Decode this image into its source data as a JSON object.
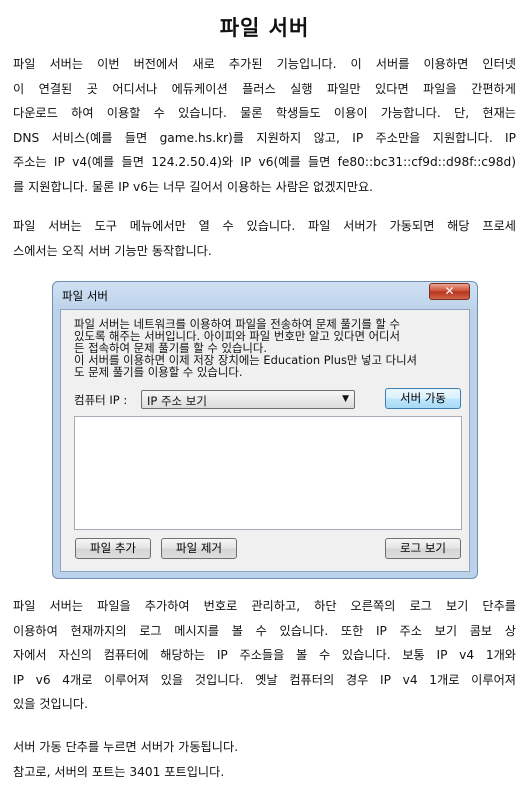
{
  "page": {
    "title": "파일 서버",
    "p1": [
      "파일 서버는 이번 버전에서 새로 추가된 기능입니다. 이 서버를 이용하면 인터넷",
      "이 연결된 곳 어디서나 에듀케이션 플러스 실행 파일만 있다면 파일을 간편하게",
      "다운로드 하여 이용할 수 있습니다. 물론 학생들도 이용이 가능합니다. 단, 현재는",
      "DNS 서비스(예를 들면 game.hs.kr)를 지원하지 않고, IP 주소만을 지원합니다. IP",
      "주소는 IP v4(예를 들면 124.2.50.4)와 IP v6(예를 들면 fe80::bc31::cf9d::d98f::c98d)",
      "를 지원합니다. 물론 IP v6는 너무 길어서 이용하는 사람은 없겠지만요."
    ],
    "p2": [
      "파일 서버는 도구 메뉴에서만 열 수 있습니다. 파일 서버가 가동되면 해당 프로세",
      "스에서는 오직 서버 기능만 동작합니다."
    ],
    "p3": [
      "파일 서버는 파일을 추가하여 번호로 관리하고, 하단 오른쪽의 로그 보기 단추를",
      "이용하여 현재까지의 로그 메시지를 볼 수 있습니다. 또한 IP 주소 보기 콤보 상",
      "자에서 자신의 컴퓨터에 해당하는 IP 주소들을 볼 수 있습니다. 보통 IP v4 1개와",
      "IP v6 4개로 이루어져 있을 것입니다. 옛날 컴퓨터의 경우 IP v4 1개로 이루어져",
      "있을 것입니다."
    ],
    "p4": [
      "서버 가동 단추를 누르면 서버가 가동됩니다.",
      "참고로, 서버의 포트는 3401 포트입니다."
    ]
  },
  "dialog": {
    "title": "파일 서버",
    "close": "✕",
    "desc": [
      "파일 서버는 네트워크를 이용하여 파일을 전송하여 문제 풀기를 할 수",
      "있도록 해주는 서버입니다. 아이피와 파일 번호만 알고 있다면 어디서",
      "든 접속하여 문제 풀기를 할 수 있습니다.",
      "이 서버를 이용하면 이제 저장 장치에는 Education Plus만 넣고 다니셔",
      "도 문제 풀기를 이용할 수 있습니다."
    ],
    "ip_label": "컴퓨터 IP :",
    "ip_selected": "IP 주소 보기",
    "serve_button": "서버 가동",
    "add_button": "파일 추가",
    "remove_button": "파일 제거",
    "log_button": "로그 보기"
  }
}
